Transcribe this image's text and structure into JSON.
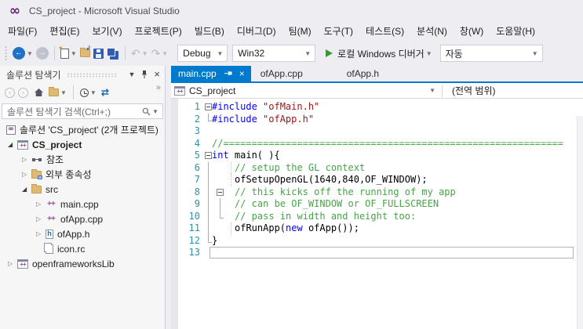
{
  "window": {
    "title": "CS_project - Microsoft Visual Studio",
    "logo_glyph": "∞"
  },
  "menu": {
    "items": [
      "파일(F)",
      "편집(E)",
      "보기(V)",
      "프로젝트(P)",
      "빌드(B)",
      "디버그(D)",
      "팀(M)",
      "도구(T)",
      "테스트(S)",
      "분석(N)",
      "창(W)",
      "도움말(H)"
    ]
  },
  "toolbar": {
    "config": "Debug",
    "platform": "Win32",
    "run_label": "로컬 Windows 디버거",
    "watch": "자동"
  },
  "solution_explorer": {
    "title": "솔루션 탐색기",
    "search_placeholder": "솔루션 탐색기 검색(Ctrl+;)",
    "tree": [
      {
        "label": "솔루션 'CS_project' (2개 프로젝트)",
        "icon": "solution",
        "level": 0,
        "arrow": "none",
        "bold": false
      },
      {
        "label": "CS_project",
        "icon": "project",
        "level": 1,
        "arrow": "expanded",
        "bold": true
      },
      {
        "label": "참조",
        "icon": "references",
        "level": 2,
        "arrow": "collapsed",
        "bold": false
      },
      {
        "label": "외부 종속성",
        "icon": "ext-deps",
        "level": 2,
        "arrow": "collapsed",
        "bold": false
      },
      {
        "label": "src",
        "icon": "folder",
        "level": 2,
        "arrow": "expanded",
        "bold": false
      },
      {
        "label": "main.cpp",
        "icon": "cpp-file",
        "level": 3,
        "arrow": "collapsed",
        "bold": false
      },
      {
        "label": "ofApp.cpp",
        "icon": "cpp-file",
        "level": 3,
        "arrow": "collapsed",
        "bold": false
      },
      {
        "label": "ofApp.h",
        "icon": "h-file",
        "level": 3,
        "arrow": "collapsed",
        "bold": false
      },
      {
        "label": "icon.rc",
        "icon": "rc-file",
        "level": 3,
        "arrow": "none",
        "bold": false
      },
      {
        "label": "openframeworksLib",
        "icon": "project",
        "level": 1,
        "arrow": "collapsed",
        "bold": false
      }
    ]
  },
  "editor": {
    "tabs": [
      {
        "label": "main.cpp",
        "active": true
      },
      {
        "label": "ofApp.cpp",
        "active": false
      },
      {
        "label": "ofApp.h",
        "active": false
      }
    ],
    "nav": {
      "project": "CS_project",
      "scope": "(전역 범위)"
    },
    "code": {
      "lines": [
        {
          "n": 1,
          "g": "box",
          "i": 0,
          "t": [
            [
              "kw",
              "#include"
            ],
            [
              "pl",
              " "
            ],
            [
              "str",
              "\"ofMain.h\""
            ]
          ]
        },
        {
          "n": 2,
          "g": "end",
          "i": 0,
          "t": [
            [
              "kw",
              "#include"
            ],
            [
              "pl",
              " "
            ],
            [
              "str",
              "\"ofApp.h\""
            ]
          ]
        },
        {
          "n": 3,
          "g": "",
          "i": 0,
          "t": []
        },
        {
          "n": 4,
          "g": "",
          "i": 0,
          "t": [
            [
              "com",
              "//============================================================"
            ]
          ]
        },
        {
          "n": 5,
          "g": "box",
          "i": 0,
          "t": [
            [
              "kw",
              "int"
            ],
            [
              "pl",
              " main( ){"
            ]
          ]
        },
        {
          "n": 6,
          "g": "bar dot",
          "i": 1,
          "t": [
            [
              "com",
              "// setup the GL context"
            ]
          ]
        },
        {
          "n": 7,
          "g": "bar dot",
          "i": 1,
          "t": [
            [
              "pl",
              "ofSetupOpenGL(1640,840,OF_WINDOW);"
            ]
          ]
        },
        {
          "n": 8,
          "g": "bar box2",
          "i": 1,
          "t": [
            [
              "com",
              "// this kicks off the running of my app"
            ]
          ]
        },
        {
          "n": 9,
          "g": "bar bar2",
          "i": 1,
          "t": [
            [
              "com",
              "// can be OF_WINDOW or OF_FULLSCREEN"
            ]
          ]
        },
        {
          "n": 10,
          "g": "bar end2",
          "i": 1,
          "t": [
            [
              "com",
              "// pass in width and height too:"
            ]
          ]
        },
        {
          "n": 11,
          "g": "bar dot",
          "i": 1,
          "t": [
            [
              "pl",
              "ofRunApp("
            ],
            [
              "kw",
              "new"
            ],
            [
              "pl",
              " ofApp());"
            ]
          ]
        },
        {
          "n": 12,
          "g": "end",
          "i": 0,
          "t": [
            [
              "pl",
              "}"
            ]
          ]
        },
        {
          "n": 13,
          "g": "",
          "i": 0,
          "current": true,
          "t": []
        }
      ]
    }
  },
  "colors": {
    "accent_blue": "#007ACC",
    "chrome_bg": "#EEEEF2",
    "keyword": "#0000FF",
    "string": "#A31515",
    "comment": "#46A546",
    "line_number": "#2B91AF",
    "run_green": "#2CA02C",
    "logo_purple": "#68217A"
  }
}
